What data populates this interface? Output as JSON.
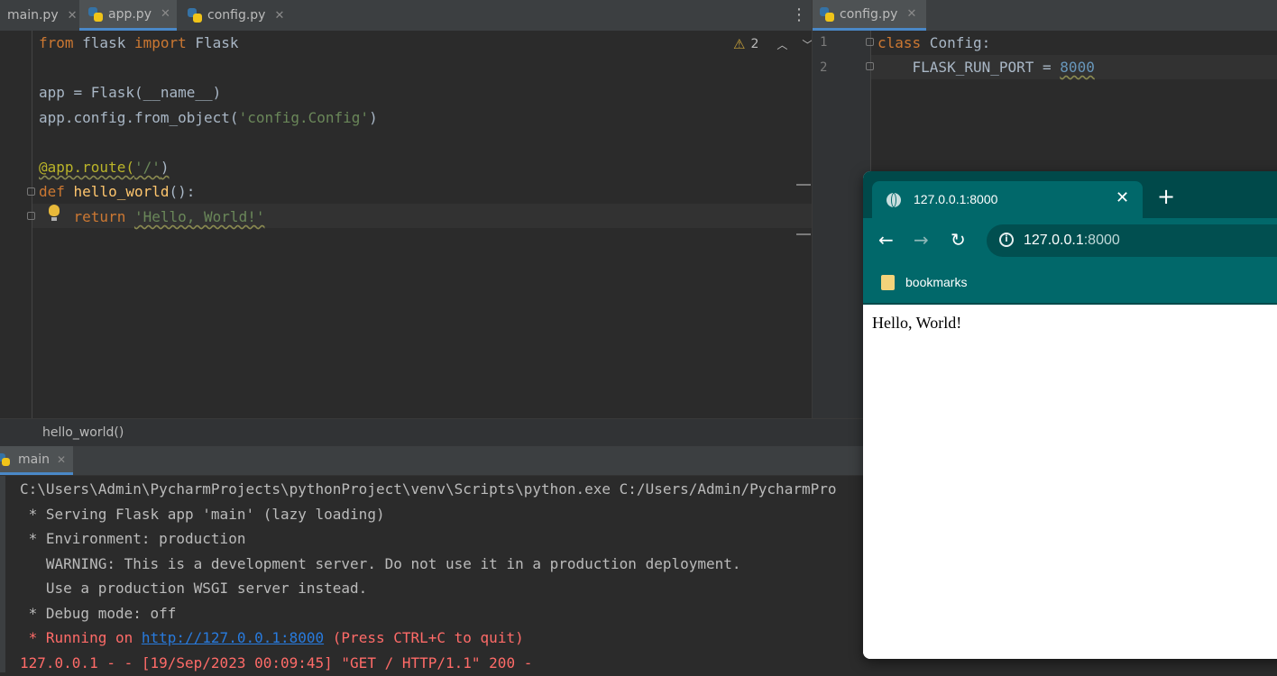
{
  "left_editor": {
    "tabs": [
      {
        "label": "main.py"
      },
      {
        "label": "app.py"
      },
      {
        "label": "config.py"
      }
    ],
    "inspection_count": "2",
    "code": {
      "l1": {
        "kw1": "from",
        "mod": " flask ",
        "kw2": "import",
        "rest": " Flask"
      },
      "l3": "app = Flask(__name__)",
      "l4": {
        "pre": "app.config.from_object(",
        "str": "'config.Config'",
        "post": ")"
      },
      "l6": {
        "dec": "@app.route(",
        "str": "'/'",
        "post": ")"
      },
      "l7": {
        "kw": "def",
        "fn": " hello_world",
        "post": "():"
      },
      "l8": {
        "kw": "return",
        "str": "'Hello, World!'"
      }
    },
    "breadcrumb": "hello_world()"
  },
  "right_editor": {
    "tab": "config.py",
    "line_numbers": [
      "1",
      "2"
    ],
    "code": {
      "l1": {
        "kw": "class",
        "rest": " Config:"
      },
      "l2": {
        "pre": "    FLASK_RUN_PORT = ",
        "num": "8000"
      }
    }
  },
  "run_panel": {
    "tab": "main",
    "lines": {
      "l1": "C:\\Users\\Admin\\PycharmProjects\\pythonProject\\venv\\Scripts\\python.exe C:/Users/Admin/PycharmPro",
      "l2": " * Serving Flask app 'main' (lazy loading)",
      "l3": " * Environment: production",
      "l4": "   WARNING: This is a development server. Do not use it in a production deployment.",
      "l5": "   Use a production WSGI server instead.",
      "l6": " * Debug mode: off",
      "l7_pre": " * Running on ",
      "l7_link": "http://127.0.0.1:8000",
      "l7_post": " (Press CTRL+C to quit)",
      "l8": "127.0.0.1 - - [19/Sep/2023 00:09:45] \"GET / HTTP/1.1\" 200 -"
    }
  },
  "browser": {
    "tab_title": "127.0.0.1:8000",
    "url_host": "127.0.0.1",
    "url_port": ":8000",
    "bookmarks_label": "bookmarks",
    "page_text": "Hello, World!",
    "theme_color": "#01686a"
  }
}
